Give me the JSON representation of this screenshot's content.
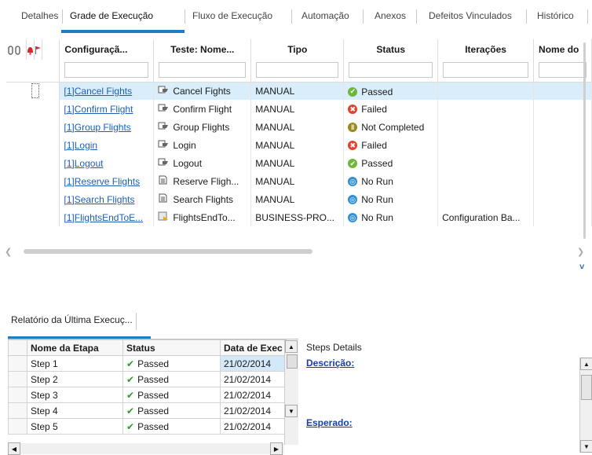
{
  "tabs": [
    "Detalhes",
    "Grade de Execução",
    "Fluxo de Execução",
    "Automação",
    "Anexos",
    "Defeitos Vinculados",
    "Histórico"
  ],
  "grid": {
    "columns": [
      "Configuraçã...",
      "Teste: Nome...",
      "Tipo",
      "Status",
      "Iterações",
      "Nome do"
    ],
    "rows": [
      {
        "config": "[1]Cancel Fights",
        "test": "Cancel Fights",
        "test_icon": "manual-test-icon",
        "type": "MANUAL",
        "status": "Passed",
        "iterations": ""
      },
      {
        "config": "[1]Confirm Flight",
        "test": "Confirm Flight",
        "test_icon": "manual-test-icon",
        "type": "MANUAL",
        "status": "Failed",
        "iterations": ""
      },
      {
        "config": "[1]Group Flights",
        "test": "Group Flights",
        "test_icon": "manual-test-icon",
        "type": "MANUAL",
        "status": "Not Completed",
        "iterations": ""
      },
      {
        "config": "[1]Login",
        "test": "Login",
        "test_icon": "manual-test-icon",
        "type": "MANUAL",
        "status": "Failed",
        "iterations": ""
      },
      {
        "config": "[1]Logout",
        "test": "Logout",
        "test_icon": "manual-test-icon",
        "type": "MANUAL",
        "status": "Passed",
        "iterations": ""
      },
      {
        "config": "[1]Reserve Flights",
        "test": "Reserve Fligh...",
        "test_icon": "document-test-icon",
        "type": "MANUAL",
        "status": "No Run",
        "iterations": ""
      },
      {
        "config": "[1]Search Flights",
        "test": "Search Flights",
        "test_icon": "document-test-icon",
        "type": "MANUAL",
        "status": "No Run",
        "iterations": ""
      },
      {
        "config": "[1]FlightsEndToE...",
        "test": "FlightsEndTo...",
        "test_icon": "business-process-icon",
        "type": "BUSINESS-PRO...",
        "status": "No Run",
        "iterations": "Configuration Ba..."
      }
    ],
    "status_colors": {
      "Passed": "#6fb63a",
      "Failed": "#e2432c",
      "Not Completed": "#9a8a1e",
      "No Run": "#2f8fd8"
    }
  },
  "report": {
    "tab_label": "Relatório da Última Execuç...",
    "columns": [
      "Nome da Etapa",
      "Status",
      "Data de Exec"
    ],
    "rows": [
      {
        "name": "Step 1",
        "status": "Passed",
        "date": "21/02/2014"
      },
      {
        "name": "Step 2",
        "status": "Passed",
        "date": "21/02/2014"
      },
      {
        "name": "Step 3",
        "status": "Passed",
        "date": "21/02/2014"
      },
      {
        "name": "Step 4",
        "status": "Passed",
        "date": "21/02/2014"
      },
      {
        "name": "Step 5",
        "status": "Passed",
        "date": "21/02/2014"
      }
    ],
    "details_title": "Steps Details",
    "description_label": "Descrição:",
    "expected_label": "Esperado:"
  },
  "colors": {
    "accent": "#1f7ec3",
    "link": "#1c5fb5",
    "selected_row": "#d9eefa"
  }
}
